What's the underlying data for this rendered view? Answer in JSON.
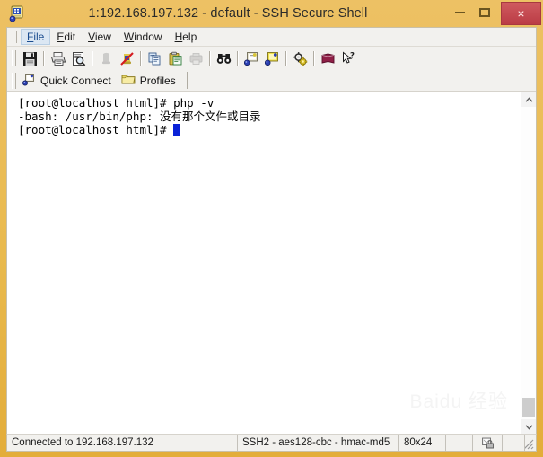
{
  "window": {
    "title": "1:192.168.197.132 - default - SSH Secure Shell",
    "app_icon_name": "ssh-terminal-icon",
    "frame_color": "#e8b845",
    "close_button_color": "#c5484f"
  },
  "titlebar_buttons": {
    "minimize_label": "–",
    "maximize_label": "☐",
    "close_label": "×"
  },
  "menu": {
    "items": [
      {
        "label": "File",
        "mnemonic": "F",
        "rest": "ile",
        "selected": true
      },
      {
        "label": "Edit",
        "mnemonic": "E",
        "rest": "dit",
        "selected": false
      },
      {
        "label": "View",
        "mnemonic": "V",
        "rest": "iew",
        "selected": false
      },
      {
        "label": "Window",
        "mnemonic": "W",
        "rest": "indow",
        "selected": false
      },
      {
        "label": "Help",
        "mnemonic": "H",
        "rest": "elp",
        "selected": false
      }
    ]
  },
  "toolbar": {
    "buttons": [
      {
        "name": "save-icon",
        "enabled": true
      },
      {
        "name": "print-icon",
        "enabled": true
      },
      {
        "name": "print-preview-icon",
        "enabled": true
      },
      {
        "name": "connect-icon",
        "enabled": false
      },
      {
        "name": "disconnect-icon",
        "enabled": true
      },
      {
        "name": "copy-icon",
        "enabled": true
      },
      {
        "name": "paste-icon",
        "enabled": true
      },
      {
        "name": "print-buffer-icon",
        "enabled": false
      },
      {
        "name": "find-icon",
        "enabled": true
      },
      {
        "name": "new-file-transfer-icon",
        "enabled": true
      },
      {
        "name": "new-terminal-icon",
        "enabled": true
      },
      {
        "name": "settings-icon",
        "enabled": true
      },
      {
        "name": "help-book-icon",
        "enabled": true
      },
      {
        "name": "context-help-icon",
        "enabled": true
      }
    ]
  },
  "quick_bar": {
    "quick_connect_label": "Quick Connect",
    "quick_connect_icon": "quick-connect-icon",
    "profiles_label": "Profiles",
    "profiles_icon": "folder-icon"
  },
  "terminal": {
    "lines": [
      {
        "text": "[root@localhost html]# php -v",
        "cursor": false
      },
      {
        "text": "-bash: /usr/bin/php: 没有那个文件或目录",
        "cursor": false
      },
      {
        "text": "[root@localhost html]# ",
        "cursor": true
      }
    ],
    "cursor_color": "#0a22d8",
    "background": "#ffffff",
    "foreground": "#000000",
    "watermark": "Baidu 经验"
  },
  "scrollbar": {
    "up_arrow": "scroll-up-arrow",
    "down_arrow": "scroll-down-arrow",
    "thumb_position": "bottom"
  },
  "statusbar": {
    "connection": "Connected to 192.168.197.132",
    "cipher": "SSH2 - aes128-cbc - hmac-md5",
    "size": "80x24",
    "tray_icon": "encryption-icon"
  }
}
